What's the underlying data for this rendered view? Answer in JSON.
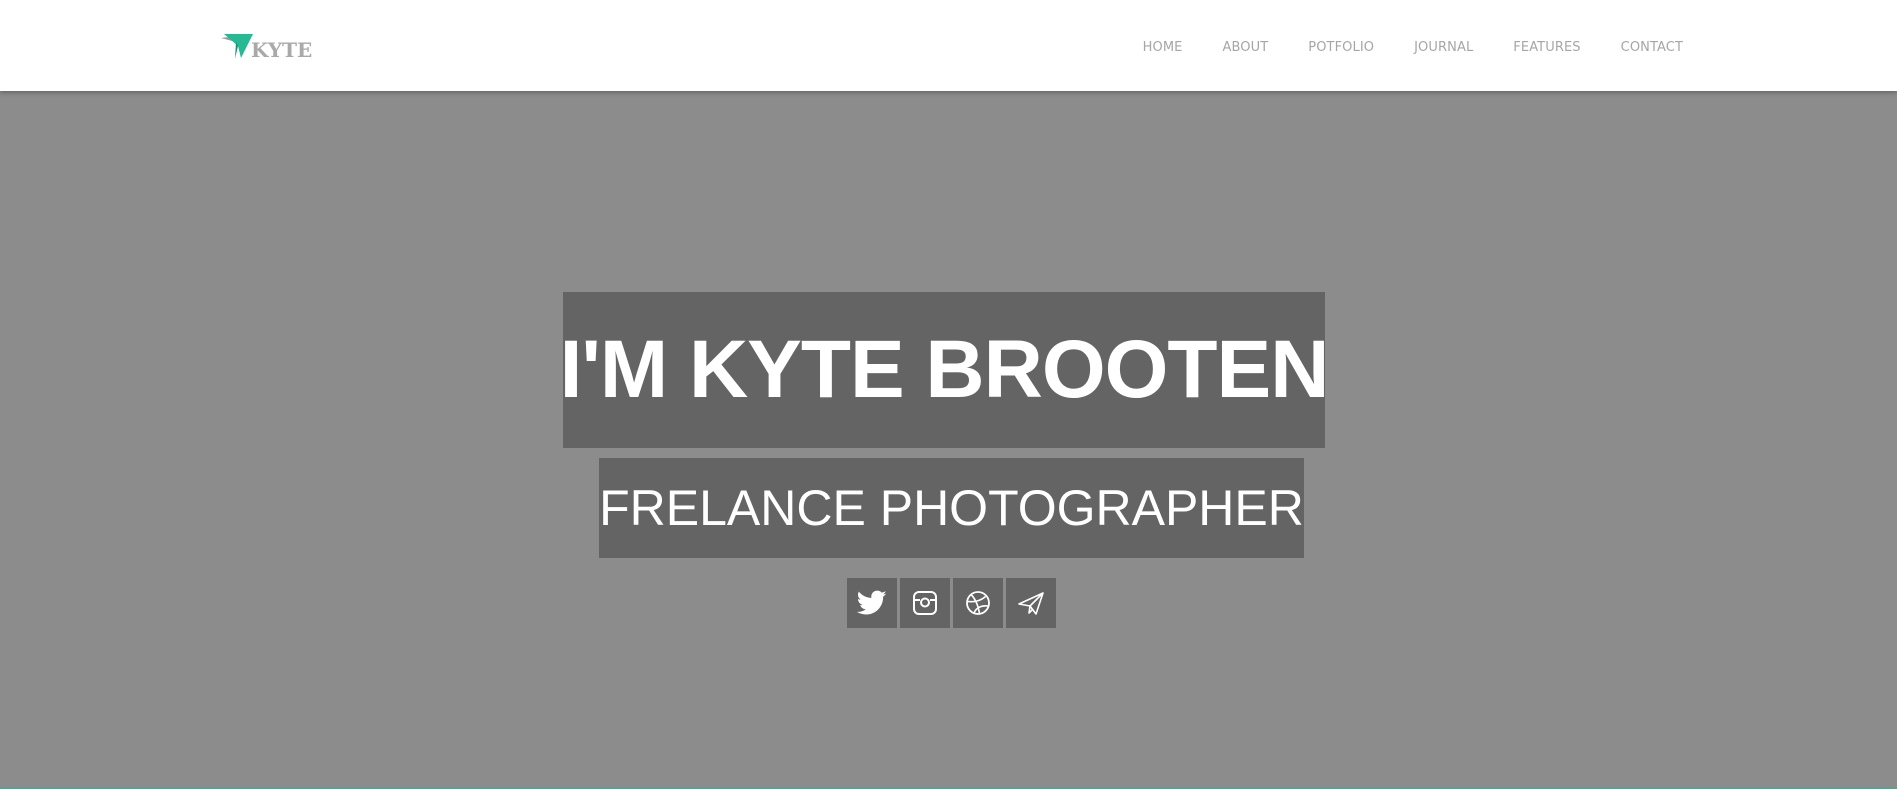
{
  "brand": {
    "name": "KYTE",
    "accent_color": "#27b894",
    "icon": "paper-plane-logo"
  },
  "nav": {
    "items": [
      {
        "label": "HOME"
      },
      {
        "label": "ABOUT"
      },
      {
        "label": "POTFOLIO"
      },
      {
        "label": "JOURNAL"
      },
      {
        "label": "FEATURES"
      },
      {
        "label": "CONTACT"
      }
    ]
  },
  "hero": {
    "title": "I'M KYTE BROOTEN",
    "subtitle": "FRELANCE PHOTOGRAPHER",
    "social": [
      {
        "icon": "twitter-icon"
      },
      {
        "icon": "instagram-icon"
      },
      {
        "icon": "dribbble-icon"
      },
      {
        "icon": "paper-plane-icon"
      }
    ]
  },
  "colors": {
    "header_bg": "#ffffff",
    "hero_bg": "#8c8c8c",
    "box_bg": "#646464",
    "nav_text": "#a6a6a6"
  }
}
